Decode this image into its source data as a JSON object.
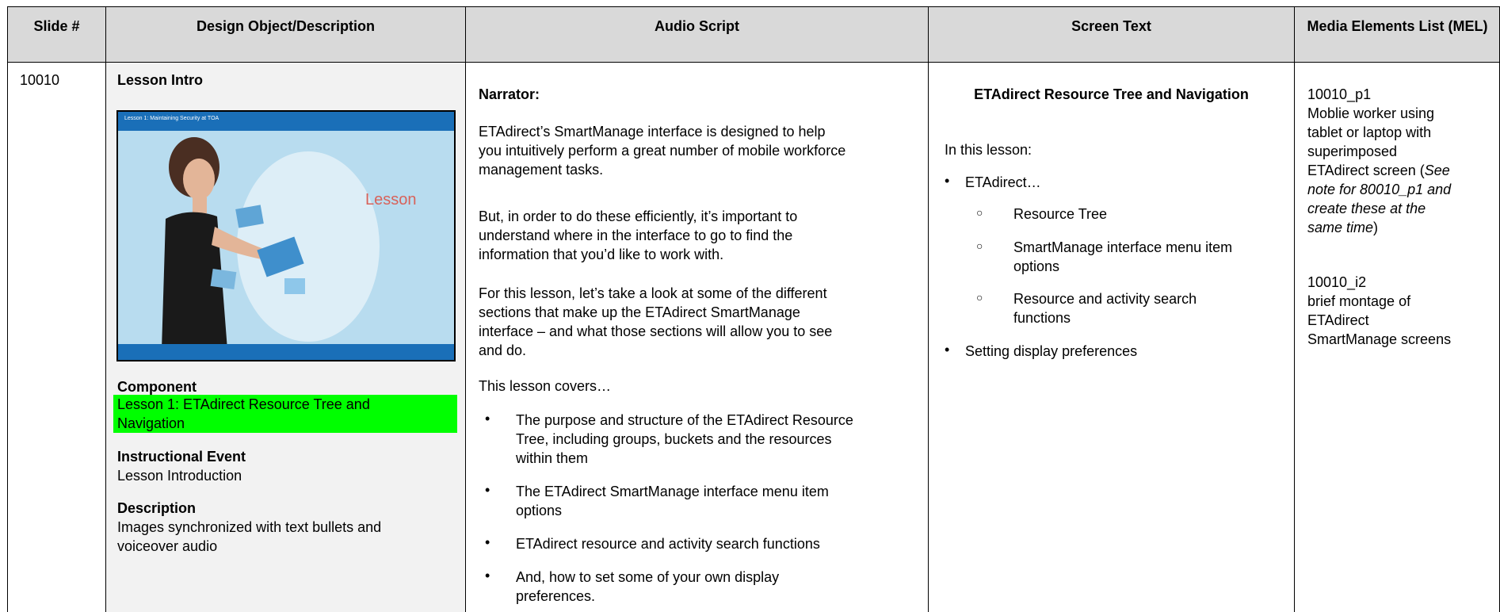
{
  "headers": {
    "slide": "Slide #",
    "design": "Design Object/Description",
    "audio": "Audio Script",
    "screen": "Screen Text",
    "mel": "Media Elements List (MEL)"
  },
  "row": {
    "slide_number": "10010",
    "design": {
      "title": "Lesson Intro",
      "thumbnail": {
        "title_text": "Lesson 1: Maintaining Security at TOA",
        "word": "Lesson"
      },
      "component_label": "Component",
      "component_value_1": "Lesson 1: ETAdirect Resource Tree and",
      "component_value_2": "Navigation",
      "event_label": "Instructional Event",
      "event_value": "Lesson Introduction",
      "description_label": "Description",
      "description_line_1": "Images synchronized with text bullets and",
      "description_line_2": "voiceover audio"
    },
    "audio": {
      "narrator": "Narrator:",
      "para1": [
        "ETAdirect’s SmartManage interface is designed to help",
        "you intuitively perform a great number of mobile workforce",
        "management tasks."
      ],
      "para2": [
        "But, in order to do these efficiently, it’s important to",
        "understand where in the interface to go to find the",
        "information that you’d like to work with."
      ],
      "para3": [
        "For this lesson, let’s take a look at some of the different",
        "sections that make up the ETAdirect SmartManage",
        "interface – and what those sections will allow you to see",
        "and do."
      ],
      "covers": "This lesson covers…",
      "bullets": [
        [
          "The purpose and structure of the ETAdirect Resource",
          "Tree, including groups, buckets and the resources",
          "within them"
        ],
        [
          "The ETAdirect SmartManage interface menu item",
          "options"
        ],
        [
          "ETAdirect resource and activity search functions"
        ],
        [
          "And, how to set some of your own display",
          "preferences."
        ]
      ]
    },
    "screen": {
      "title": "ETAdirect Resource Tree and Navigation",
      "intro": "In this lesson:",
      "item1": "ETAdirect…",
      "sub1": "Resource Tree",
      "sub2": [
        "SmartManage interface menu item",
        "options"
      ],
      "sub3": [
        "Resource and activity search",
        "functions"
      ],
      "item2": "Setting display preferences"
    },
    "mel": {
      "id1": "10010_p1",
      "desc1": [
        "Moblie worker using",
        "tablet or laptop with",
        "superimposed"
      ],
      "desc1_line4_plain": "ETAdirect screen (",
      "desc1_line4_italic": "See",
      "desc1_italic_lines": [
        "note for 80010_p1 and",
        "create these at the"
      ],
      "desc1_last_italic": "same time",
      "desc1_last_plain": ")",
      "id2": "10010_i2",
      "desc2": [
        "brief montage of",
        "ETAdirect",
        "SmartManage screens"
      ]
    }
  }
}
